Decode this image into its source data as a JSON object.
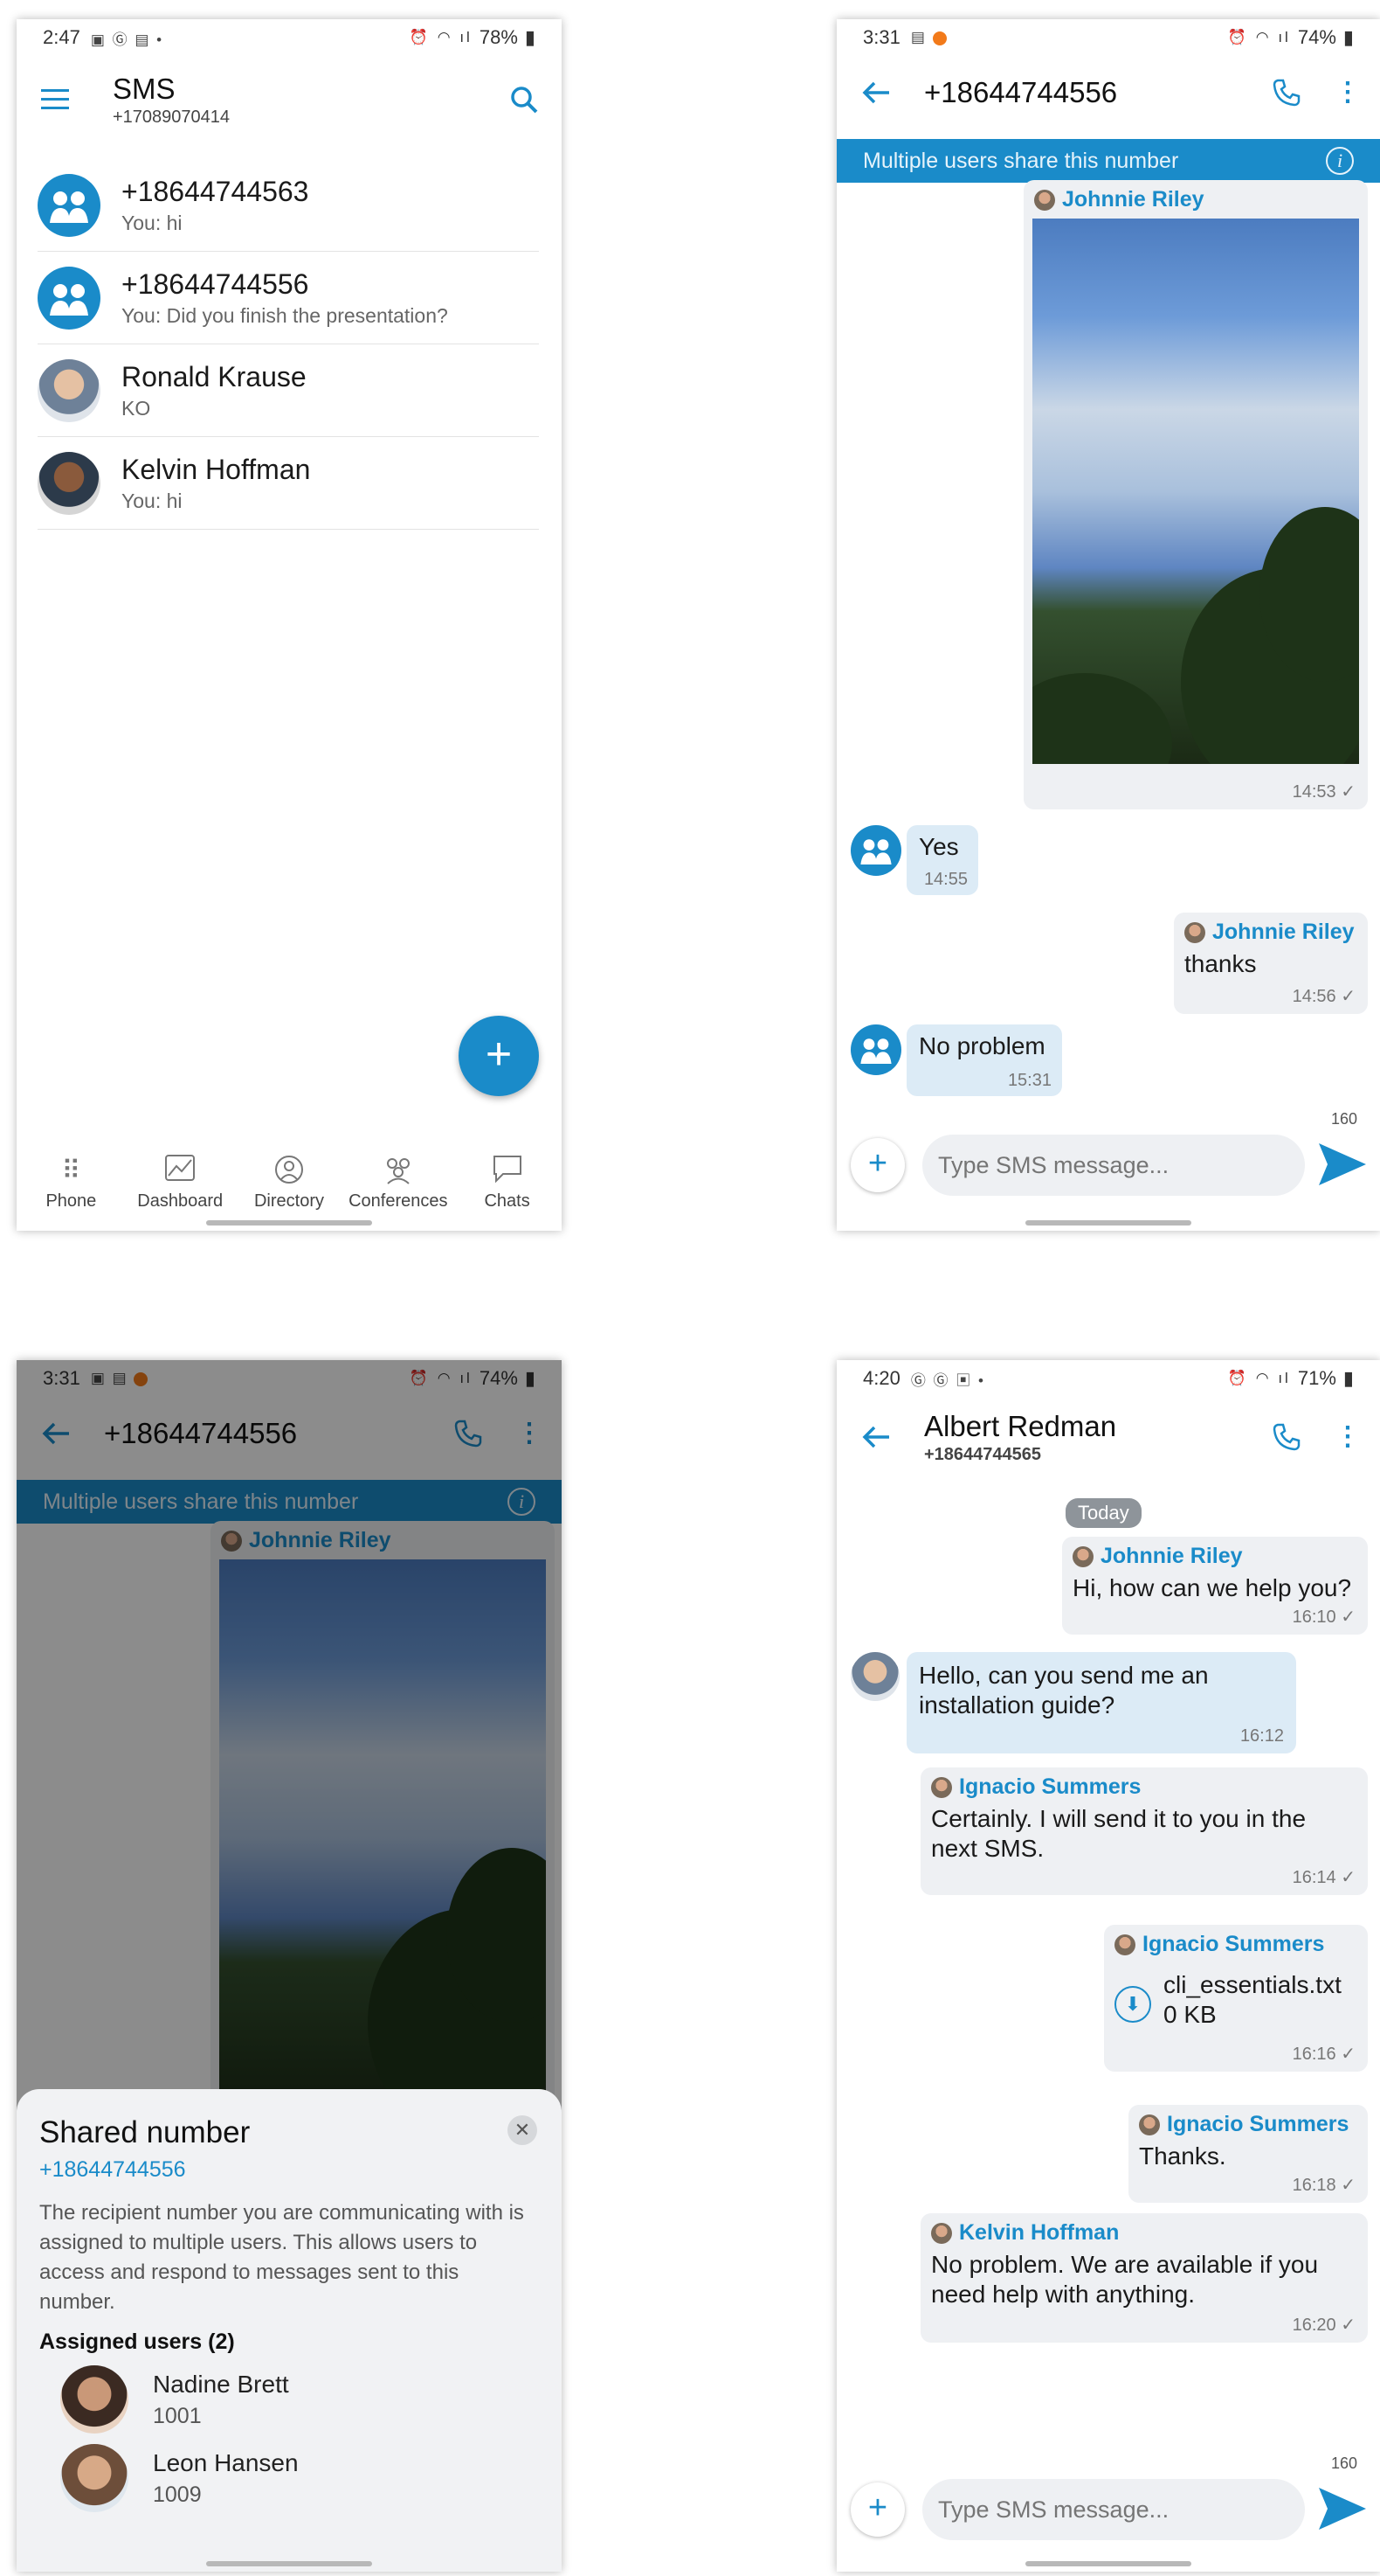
{
  "phone1": {
    "status": {
      "time": "2:47",
      "battery": "78%"
    },
    "title": "SMS",
    "subtitle": "+17089070414",
    "conversations": [
      {
        "name": "+18644744563",
        "preview": "You: hi"
      },
      {
        "name": "+18644744556",
        "preview": "You: Did you finish the presentation?"
      },
      {
        "name": "Ronald Krause",
        "preview": "KO"
      },
      {
        "name": "Kelvin Hoffman",
        "preview": "You: hi"
      }
    ],
    "fab": "+",
    "nav": [
      {
        "label": "Phone"
      },
      {
        "label": "Dashboard"
      },
      {
        "label": "Directory"
      },
      {
        "label": "Conferences"
      },
      {
        "label": "Chats"
      }
    ]
  },
  "phone2": {
    "status": {
      "time": "3:31",
      "battery": "74%"
    },
    "title": "+18644744556",
    "banner": "Multiple users share this number",
    "messages": {
      "m1": {
        "sender": "Johnnie Riley",
        "time": "14:53 ✓"
      },
      "m2": {
        "text": "Yes",
        "time": "14:55"
      },
      "m3": {
        "sender": "Johnnie Riley",
        "text": "thanks",
        "time": "14:56 ✓"
      },
      "m4": {
        "text": "No problem",
        "time": "15:31"
      }
    },
    "composer": {
      "placeholder": "Type SMS message...",
      "count": "160"
    }
  },
  "phone3": {
    "status": {
      "time": "3:31",
      "battery": "74%"
    },
    "title": "+18644744556",
    "banner": "Multiple users share this number",
    "sender": "Johnnie Riley",
    "sheet": {
      "title": "Shared number",
      "number": "+18644744556",
      "description": "The recipient number you are communicating with is assigned to multiple users. This allows users to access and respond to messages sent to this number.",
      "assigned_label": "Assigned users (2)",
      "users": [
        {
          "name": "Nadine Brett",
          "ext": "1001"
        },
        {
          "name": "Leon Hansen",
          "ext": "1009"
        }
      ]
    }
  },
  "phone4": {
    "status": {
      "time": "4:20",
      "battery": "71%"
    },
    "title": "Albert Redman",
    "subtitle": "+18644744565",
    "today": "Today",
    "messages": {
      "m1": {
        "sender": "Johnnie Riley",
        "text": "Hi, how can we help you?",
        "time": "16:10 ✓"
      },
      "m2": {
        "text1": "Hello, can you send me an",
        "text2": "installation guide?",
        "time": "16:12"
      },
      "m3": {
        "sender": "Ignacio Summers",
        "text1": "Certainly. I will send it to you in the",
        "text2": "next SMS.",
        "time": "16:14 ✓"
      },
      "m4": {
        "sender": "Ignacio Summers",
        "file": "cli_essentials.txt",
        "size": "0 KB",
        "time": "16:16 ✓"
      },
      "m5": {
        "sender": "Ignacio Summers",
        "text": "Thanks.",
        "time": "16:18 ✓"
      },
      "m6": {
        "sender": "Kelvin Hoffman",
        "text1": "No problem. We are available if you",
        "text2": "need help with anything.",
        "time": "16:20 ✓"
      }
    },
    "composer": {
      "placeholder": "Type SMS message...",
      "count": "160"
    }
  },
  "colors": {
    "accent": "#1a8bc9",
    "bubble_out": "#eef0f3",
    "bubble_in": "#dcebf6"
  }
}
